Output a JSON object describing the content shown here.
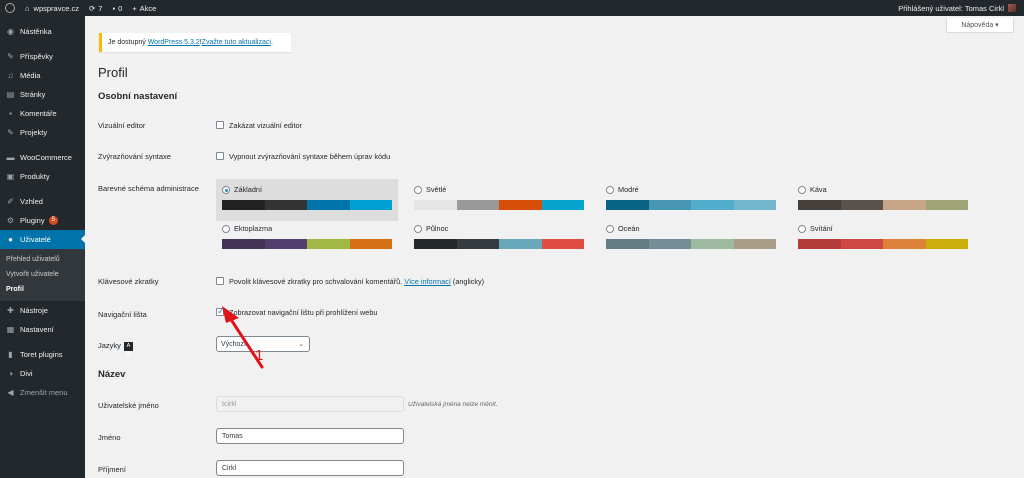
{
  "adminbar": {
    "site_name": "wpspravce.cz",
    "updates_count": "7",
    "comments_count": "0",
    "new_label": "Akce",
    "user_greeting": "Přihlášený uživatel: Tomas Cirkl"
  },
  "sidebar": {
    "dashboard": "Nástěnka",
    "posts": "Příspěvky",
    "media": "Média",
    "pages": "Stránky",
    "comments": "Komentáře",
    "projects": "Projekty",
    "woocommerce": "WooCommerce",
    "products": "Produkty",
    "appearance": "Vzhled",
    "plugins": "Pluginy",
    "plugins_badge": "5",
    "users": "Uživatelé",
    "sub_users_all": "Přehled uživatelů",
    "sub_users_new": "Vytvořit uživatele",
    "sub_users_profile": "Profil",
    "tools": "Nástroje",
    "settings": "Nastavení",
    "toret": "Toret plugins",
    "divi": "Divi",
    "collapse": "Zmenšit menu"
  },
  "help_button": "Nápověda ▾",
  "notice": {
    "prefix": "Je dostupný ",
    "link1": "WordPress 5.3.2",
    "middle": "! ",
    "link2": "Zvažte tuto aktualizaci",
    "suffix": "."
  },
  "page_title": "Profil",
  "sections": {
    "personal": "Osobní nastavení",
    "name": "Název"
  },
  "fields": {
    "visual_editor_label": "Vizuální editor",
    "visual_editor_cb": "Zakázat vizuální editor",
    "syntax_label": "Zvýrazňování syntaxe",
    "syntax_cb": "Vypnout zvýrazňování syntaxe během úprav kódu",
    "admin_color_label": "Barevné schéma administrace",
    "shortcuts_label": "Klávesové zkratky",
    "shortcuts_cb": "Povolit klávesové zkratky pro schvalování komentářů. ",
    "shortcuts_link": "Více informací",
    "shortcuts_suffix": " (anglicky)",
    "toolbar_label": "Navigační lišta",
    "toolbar_cb": "Zobrazovat navigační lištu při prohlížení webu",
    "language_label": "Jazyky",
    "language_value": "Výchozí",
    "username_label": "Uživatelské jméno",
    "username_value": "tcirkl",
    "username_desc": "Uživatelská jména nelze měnit.",
    "first_name_label": "Jméno",
    "first_name_value": "Tomas",
    "last_name_label": "Příjmení",
    "last_name_value": "Cirkl"
  },
  "color_schemes": [
    {
      "name": "Základní",
      "selected": true,
      "colors": [
        "#222222",
        "#333333",
        "#0073aa",
        "#00a0d2"
      ]
    },
    {
      "name": "Světlé",
      "selected": false,
      "colors": [
        "#e5e5e5",
        "#999999",
        "#d64e07",
        "#04a4cc"
      ]
    },
    {
      "name": "Modré",
      "selected": false,
      "colors": [
        "#096484",
        "#4796b3",
        "#52accc",
        "#74b6ce"
      ]
    },
    {
      "name": "Káva",
      "selected": false,
      "colors": [
        "#46403c",
        "#59524c",
        "#c7a589",
        "#9ea476"
      ]
    },
    {
      "name": "Ektoplazma",
      "selected": false,
      "colors": [
        "#413256",
        "#523f6d",
        "#a3b745",
        "#d46f15"
      ]
    },
    {
      "name": "Půlnoc",
      "selected": false,
      "colors": [
        "#25282b",
        "#363b3f",
        "#69a8bb",
        "#e14d43"
      ]
    },
    {
      "name": "Oceán",
      "selected": false,
      "colors": [
        "#627c83",
        "#738e96",
        "#9ebaa0",
        "#aa9d88"
      ]
    },
    {
      "name": "Svítání",
      "selected": false,
      "colors": [
        "#b43c38",
        "#cf4944",
        "#dd823b",
        "#ccaf0b"
      ]
    }
  ],
  "annotation": {
    "label": "1",
    "color": "#e0131b"
  },
  "colors": {
    "adminbar_bg": "#23282d",
    "sidebar_bg": "#23282d",
    "active_menu": "#0073aa",
    "notice_border": "#ffb900",
    "link": "#0073aa"
  }
}
